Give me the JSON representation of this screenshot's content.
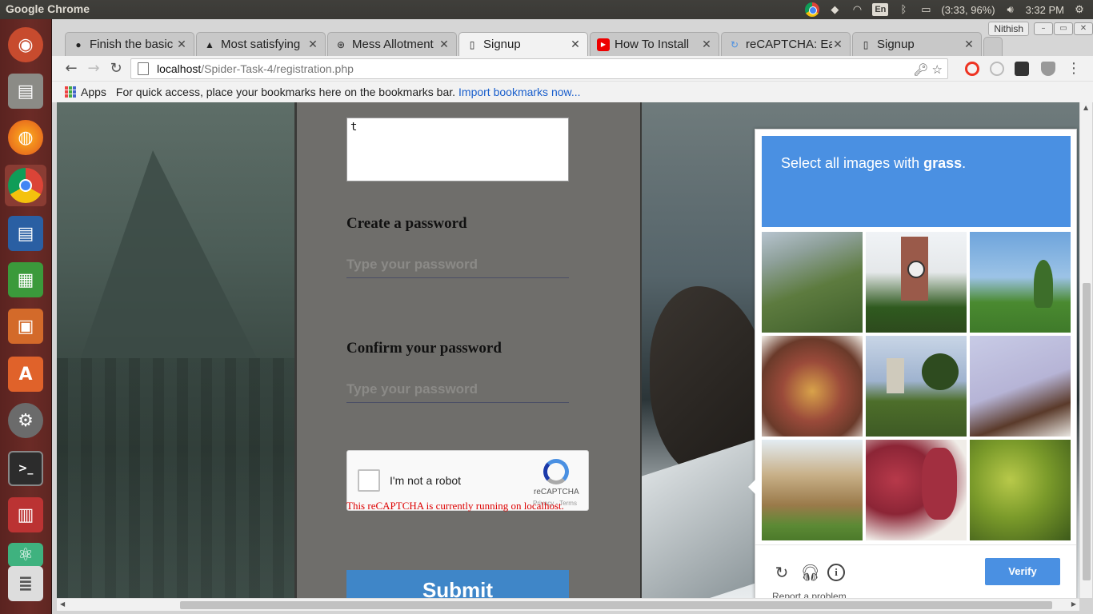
{
  "system": {
    "app_title": "Google Chrome",
    "battery": "(3:33, 96%)",
    "time": "3:32 PM",
    "keyboard_layout": "En"
  },
  "launcher": {
    "items": [
      "ubuntu-dash-icon",
      "files-icon",
      "firefox-icon",
      "chrome-icon",
      "writer-icon",
      "calc-icon",
      "impress-icon",
      "software-center-icon",
      "system-settings-icon",
      "terminal-icon",
      "reader-icon",
      "atom-icon",
      "workspace-icon"
    ]
  },
  "browser": {
    "profile": "Nithish",
    "tabs": [
      {
        "label": "Finish the basic",
        "icon": "github-icon",
        "active": false
      },
      {
        "label": "Most satisfying",
        "icon": "reddit-icon",
        "active": false
      },
      {
        "label": "Mess Allotment",
        "icon": "site-icon",
        "active": false
      },
      {
        "label": "Signup",
        "icon": "page-icon",
        "active": true
      },
      {
        "label": "How To Install",
        "icon": "youtube-icon",
        "active": false
      },
      {
        "label": "reCAPTCHA: Ea",
        "icon": "recaptcha-icon",
        "active": false
      },
      {
        "label": "Signup",
        "icon": "page-icon",
        "active": false
      }
    ],
    "url_host": "localhost",
    "url_path": "/Spider-Task-4/registration.php",
    "bookmarks": {
      "apps_label": "Apps",
      "hint": "For quick access, place your bookmarks here on the bookmarks bar.",
      "import_link": "Import bookmarks now..."
    }
  },
  "form": {
    "textarea_value": "t",
    "password_label": "Create a password",
    "password_placeholder": "Type your password",
    "confirm_label": "Confirm your password",
    "confirm_placeholder": "Type your password",
    "recaptcha": {
      "checkbox_label": "I'm not a robot",
      "brand": "reCAPTCHA",
      "terms": "Privacy - Terms",
      "warning": "This reCAPTCHA is currently running on localhost."
    },
    "submit_label": "Submit"
  },
  "challenge": {
    "instruction_prefix": "Select all images with ",
    "instruction_target": "grass",
    "instruction_suffix": ".",
    "tiles": [
      "mountain-meadow",
      "clock-tower",
      "park-fountain",
      "dessert-plate",
      "hill-tower",
      "yarn-spool",
      "stone-house",
      "red-grapes",
      "green-grapes"
    ],
    "verify_label": "Verify",
    "report_label": "Report a problem"
  }
}
